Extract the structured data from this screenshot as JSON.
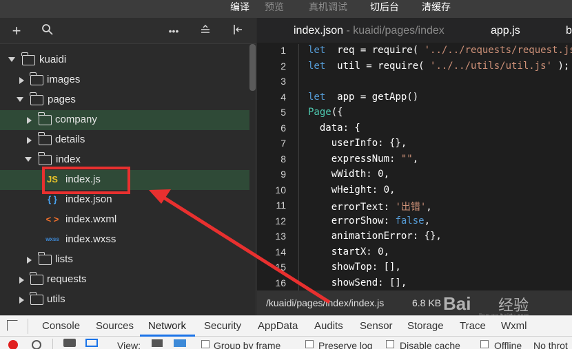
{
  "menu": {
    "items": [
      {
        "label": "编译",
        "dim": false
      },
      {
        "label": "预览",
        "dim": true
      },
      {
        "label": "真机调试",
        "dim": true
      },
      {
        "label": "切后台",
        "dim": false
      },
      {
        "label": "清缓存",
        "dim": false
      }
    ]
  },
  "sidebar": {
    "tools": [
      "add-icon",
      "search-icon",
      "more-icon",
      "collapse-icon",
      "split-icon"
    ],
    "tree": [
      {
        "label": "kuaidi",
        "type": "folder",
        "state": "open"
      },
      {
        "label": "images",
        "type": "folder",
        "state": "closed"
      },
      {
        "label": "pages",
        "type": "folder",
        "state": "open"
      },
      {
        "label": "company",
        "type": "folder",
        "state": "closed"
      },
      {
        "label": "details",
        "type": "folder",
        "state": "closed"
      },
      {
        "label": "index",
        "type": "folder",
        "state": "open"
      },
      {
        "label": "index.js",
        "type": "js",
        "icon": "JS",
        "selected": true
      },
      {
        "label": "index.json",
        "type": "json",
        "icon": "{ }"
      },
      {
        "label": "index.wxml",
        "type": "wxml",
        "icon": "< >"
      },
      {
        "label": "index.wxss",
        "type": "wxss",
        "icon": "wxss"
      },
      {
        "label": "lists",
        "type": "folder",
        "state": "closed"
      },
      {
        "label": "requests",
        "type": "folder",
        "state": "closed"
      },
      {
        "label": "utils",
        "type": "folder",
        "state": "closed"
      }
    ]
  },
  "editor": {
    "tabs": [
      {
        "name": "index.json",
        "path": " - kuaidi/pages/index"
      },
      {
        "name": "app.js",
        "path": ""
      },
      {
        "name": "b",
        "path": ""
      }
    ],
    "lines": [
      {
        "n": "1",
        "code": [
          [
            "kw",
            "let"
          ],
          [
            "",
            "  req = require( "
          ],
          [
            "str",
            "'../../requests/request.js'"
          ]
        ]
      },
      {
        "n": "2",
        "code": [
          [
            "kw",
            "let"
          ],
          [
            "",
            "  util = require( "
          ],
          [
            "str",
            "'../../utils/util.js'"
          ],
          [
            "",
            " );"
          ]
        ]
      },
      {
        "n": "3",
        "code": []
      },
      {
        "n": "4",
        "code": [
          [
            "kw",
            "let"
          ],
          [
            "",
            "  app = getApp()"
          ]
        ]
      },
      {
        "n": "5",
        "code": [
          [
            "cls",
            "Page"
          ],
          [
            "",
            "({"
          ]
        ]
      },
      {
        "n": "6",
        "code": [
          [
            "",
            "  data: {"
          ]
        ]
      },
      {
        "n": "7",
        "code": [
          [
            "",
            "    userInfo: {},"
          ]
        ]
      },
      {
        "n": "8",
        "code": [
          [
            "",
            "    expressNum: "
          ],
          [
            "str",
            "\"\""
          ],
          [
            "",
            ","
          ]
        ]
      },
      {
        "n": "9",
        "code": [
          [
            "",
            "    wWidth: 0,"
          ]
        ]
      },
      {
        "n": "10",
        "code": [
          [
            "",
            "    wHeight: 0,"
          ]
        ]
      },
      {
        "n": "11",
        "code": [
          [
            "",
            "    errorText: "
          ],
          [
            "str",
            "'出错'"
          ],
          [
            "",
            ","
          ]
        ]
      },
      {
        "n": "12",
        "code": [
          [
            "",
            "    errorShow: "
          ],
          [
            "kw",
            "false"
          ],
          [
            "",
            ","
          ]
        ]
      },
      {
        "n": "13",
        "code": [
          [
            "",
            "    animationError: {},"
          ]
        ]
      },
      {
        "n": "14",
        "code": [
          [
            "",
            "    startX: 0,"
          ]
        ]
      },
      {
        "n": "15",
        "code": [
          [
            "",
            "    showTop: [],"
          ]
        ]
      },
      {
        "n": "16",
        "code": [
          [
            "",
            "    showSend: [],"
          ]
        ]
      }
    ],
    "status": {
      "path": "/kuaidi/pages/index/index.js",
      "size": "6.8 KB"
    },
    "watermark": {
      "brand": "Bai",
      "brand2": "经验",
      "url": "jingyan.baidu.com"
    }
  },
  "devtools": {
    "tabs": [
      "Console",
      "Sources",
      "Network",
      "Security",
      "AppData",
      "Audits",
      "Sensor",
      "Storage",
      "Trace",
      "Wxml"
    ],
    "active": "Network",
    "toolbar": {
      "view": "View:",
      "group": "Group by frame",
      "preserve": "Preserve log",
      "cache": "Disable cache",
      "offline": "Offline",
      "throttle": "No throt"
    }
  },
  "colors": {
    "accent": "#e8302f",
    "selected_row": "#2f4a37",
    "tab_underline": "#1a73e8"
  }
}
